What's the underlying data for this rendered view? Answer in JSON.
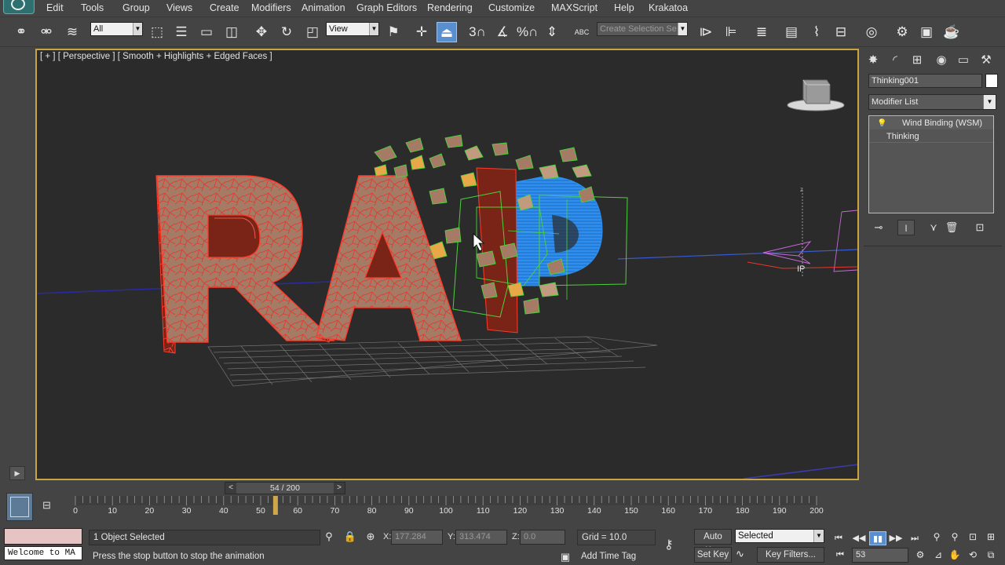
{
  "menu": {
    "items": [
      "Edit",
      "Tools",
      "Group",
      "Views",
      "Create",
      "Modifiers",
      "Animation",
      "Graph Editors",
      "Rendering",
      "Customize",
      "MAXScript",
      "Help",
      "Krakatoa"
    ]
  },
  "toolbar": {
    "selection_filter": "All",
    "ref_coord": "View",
    "named_selection_placeholder": "Create Selection Se",
    "snap_label": "3",
    "percent_label": "%",
    "abc_label": "ABC"
  },
  "viewport": {
    "label": "[ + ] [ Perspective ] [ Smooth + Highlights + Edged Faces ]",
    "gizmo_text": "IP",
    "axis_z": "z"
  },
  "command_panel": {
    "object_name": "Thinking001",
    "modifier_list": "Modifier List",
    "stack": [
      "Wind Binding (WSM)",
      "Thinking"
    ]
  },
  "timeline": {
    "current_frame": 54,
    "total_frames": 200,
    "slider_label": "54 / 200",
    "prev": "<",
    "next": ">",
    "ticks": [
      "0",
      "10",
      "20",
      "30",
      "40",
      "50",
      "60",
      "70",
      "80",
      "90",
      "100",
      "110",
      "120",
      "130",
      "140",
      "150",
      "160",
      "170",
      "180",
      "190",
      "200"
    ]
  },
  "status": {
    "maxscript_output": "Welcome to MA",
    "selection": "1 Object Selected",
    "prompt": "Press the stop button to stop the animation",
    "x_label": "X:",
    "x_value": "177.284",
    "y_label": "Y:",
    "y_value": "313.474",
    "z_label": "Z:",
    "z_value": "0.0",
    "grid": "Grid = 10.0",
    "add_time_tag": "Add Time Tag",
    "auto_key": "Auto Key",
    "set_key": "Set Key",
    "key_mode": "Selected",
    "key_filters": "Key Filters...",
    "frame": "53"
  },
  "colors": {
    "viewport_bg": "#2b2b2b",
    "viewport_border": "#c9a542",
    "text_red": "#e8372c",
    "text_face": "#a67b66",
    "sphere_blue": "#2f8ff0",
    "fragments_green": "#4cd23c"
  },
  "icons": [
    "link-icon",
    "unlink-icon",
    "bind-space-warp-icon",
    "select-object-icon",
    "select-by-name-icon",
    "rect-region-icon",
    "window-crossing-icon",
    "move-icon",
    "rotate-icon",
    "scale-icon",
    "use-pivot-icon",
    "select-manipulate-icon",
    "keyboard-shortcut-icon",
    "snaps-toggle-icon",
    "angle-snap-icon",
    "percent-snap-icon",
    "spinner-snap-icon",
    "edit-named-sets-icon",
    "mirror-icon",
    "align-icon",
    "layer-manager-icon",
    "graphite-ribbon-icon",
    "curve-editor-icon",
    "schematic-view-icon",
    "material-editor-icon",
    "render-setup-icon",
    "rendered-frame-icon",
    "render-icon"
  ]
}
